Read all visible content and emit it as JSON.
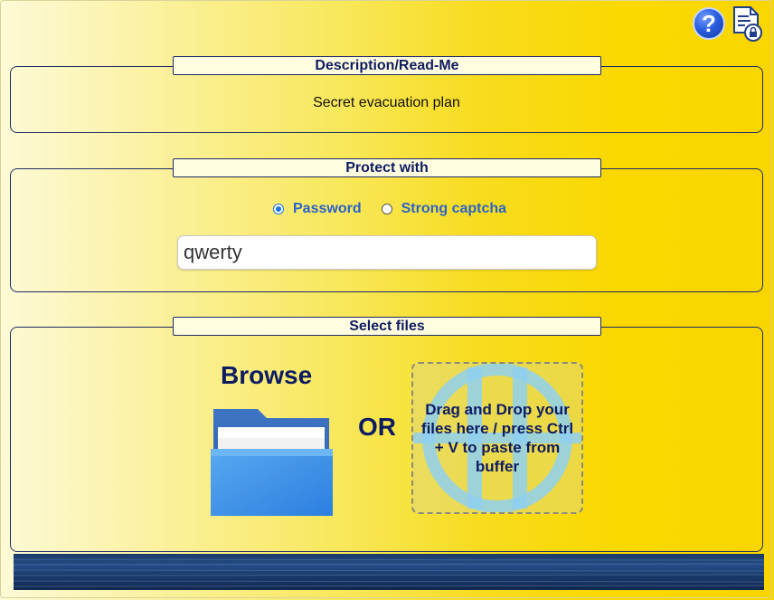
{
  "header": {
    "help_icon_glyph": "?",
    "icons": [
      "help-icon",
      "document-lock-icon"
    ]
  },
  "description": {
    "title": "Description/Read-Me",
    "text": "Secret evacuation plan"
  },
  "protect": {
    "title": "Protect with",
    "options": [
      {
        "label": "Password",
        "checked": true
      },
      {
        "label": "Strong captcha",
        "checked": false
      }
    ],
    "password_value": "qwerty"
  },
  "files": {
    "title": "Select files",
    "browse_label": "Browse",
    "or_label": "OR",
    "drop_text": "Drag and Drop your files here / press Ctrl + V to paste from buffer"
  },
  "colors": {
    "accent_blue": "#2a63c8",
    "title_navy": "#0d1b63",
    "background_yellow": "#f9d600"
  }
}
